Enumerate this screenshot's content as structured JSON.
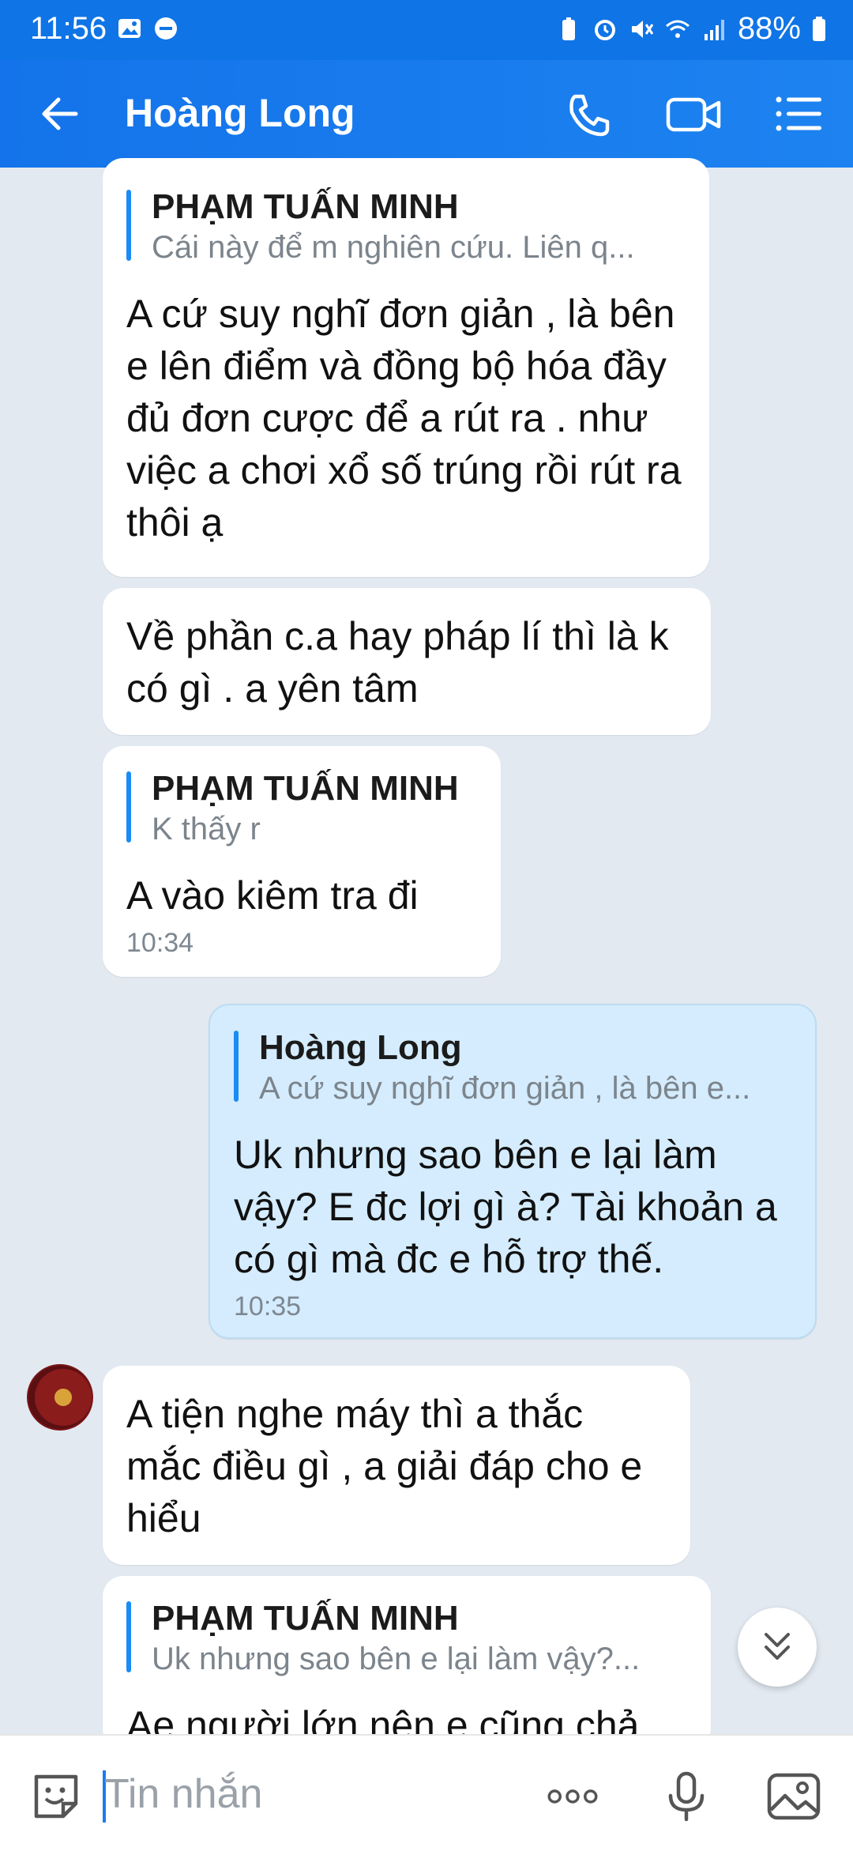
{
  "status_bar": {
    "time": "11:56",
    "battery": "88%"
  },
  "header": {
    "title": "Hoàng Long",
    "icons": [
      "back-arrow-icon",
      "phone-icon",
      "video-call-icon",
      "menu-list-icon"
    ]
  },
  "messages": [
    {
      "direction": "in",
      "quote_author": "PHẠM TUẤN MINH",
      "quote_text": "Cái này để m nghiên cứu. Liên q...",
      "text": "A cứ suy nghĩ đơn giản , là bên e lên điểm và đồng bộ hóa đầy đủ đơn cược để a rút ra . như việc a chơi xổ số trúng rồi rút ra thôi ạ"
    },
    {
      "direction": "in",
      "text": "Về phần c.a hay pháp lí thì là k có gì . a yên tâm"
    },
    {
      "direction": "in",
      "quote_author": "PHẠM TUẤN MINH",
      "quote_text": "K thấy r",
      "text": "A vào kiêm tra đi",
      "time": "10:34"
    },
    {
      "direction": "out",
      "quote_author": "Hoàng Long",
      "quote_text": "A cứ suy nghĩ đơn giản , là bên e...",
      "text": "Uk nhưng sao bên e lại làm vậy? E đc lợi gì à? Tài khoản a có gì mà đc e hỗ trợ thế.",
      "time": "10:35"
    },
    {
      "direction": "in",
      "text": "A tiện nghe máy thì a thắc mắc điều gì , a giải đáp cho e hiểu"
    },
    {
      "direction": "in",
      "quote_author": "PHẠM TUẤN MINH",
      "quote_text": "Uk nhưng sao bên e lại làm vậy?...",
      "text": "Ae người lớn nên e cũng chả"
    }
  ],
  "input_bar": {
    "placeholder": "Tin nhắn",
    "icons": [
      "sticker-icon",
      "more-options-icon",
      "microphone-icon",
      "image-icon"
    ]
  },
  "colors": {
    "header": "#1473ea",
    "chat_background": "#e2e9f1",
    "outgoing_bubble": "#d4ecfd",
    "incoming_bubble": "#ffffff",
    "quote_bar": "#1a8cf5"
  }
}
